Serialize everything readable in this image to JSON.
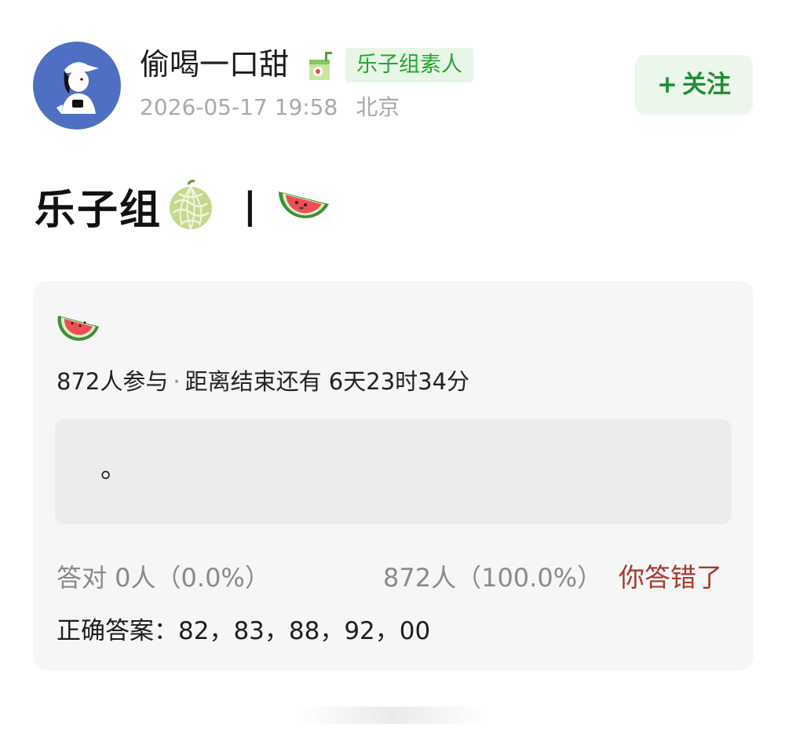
{
  "post": {
    "author": {
      "name": "偷喝一口甜",
      "badge_icon": "juice-box-icon",
      "badge": "乐子组素人",
      "avatar_icon": "cartoon-person-avatar"
    },
    "meta": {
      "datetime": "2026-05-17 19:58",
      "location": "北京"
    },
    "follow": {
      "plus": "+",
      "label": "关注"
    },
    "title": {
      "text": "乐子组",
      "separator": "|",
      "icons": [
        "melon-icon",
        "watermelon-icon"
      ]
    }
  },
  "quiz": {
    "icon": "watermelon-icon",
    "participants": "872人参与",
    "dot": "·",
    "remaining": "距离结束还有 6天23时34分",
    "option": "。",
    "correct_stat": "答对  0人（0.0%）",
    "wrong_stat": "872人（100.0%）",
    "wrong_message": "你答错了",
    "answer": "正确答案：82，83，88，92，00"
  },
  "colors": {
    "accent_green": "#25a52f",
    "follow_bg": "#ecf7ec",
    "wrong_red": "#a63a2c",
    "avatar_blue": "#4e6fc2"
  }
}
